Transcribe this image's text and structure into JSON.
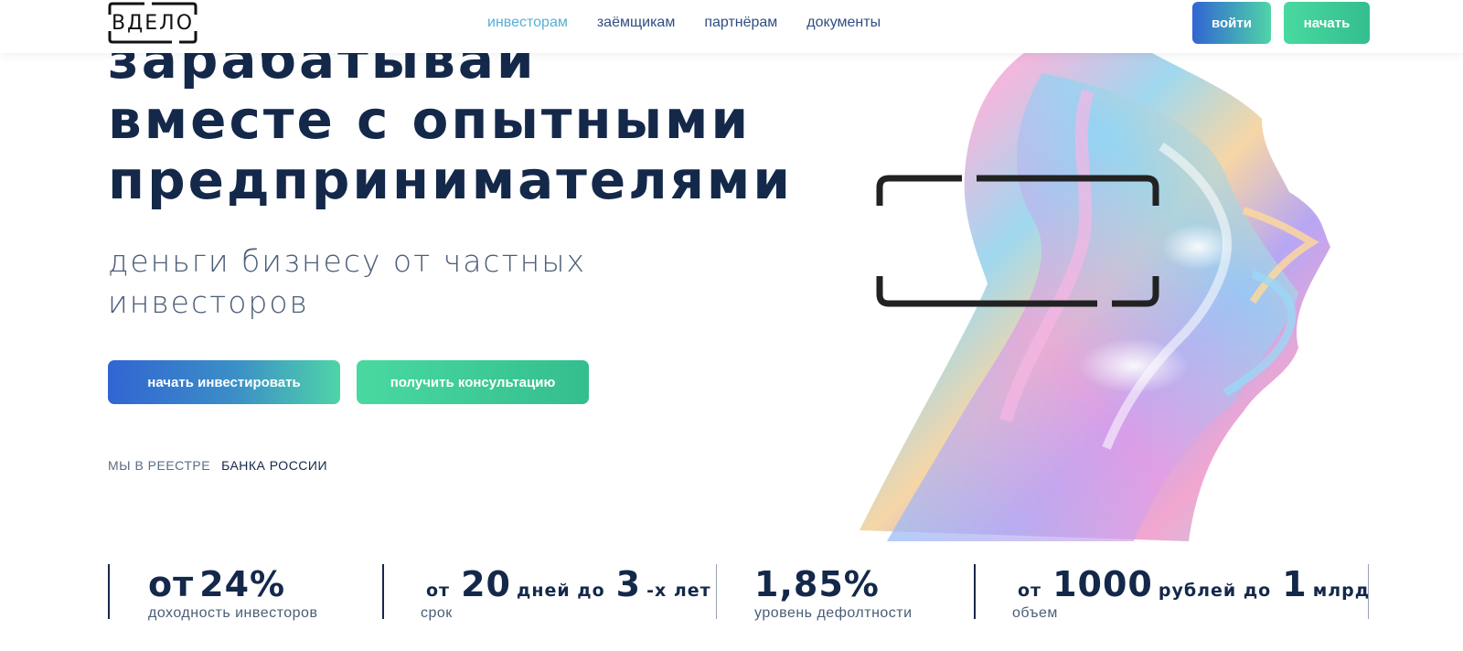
{
  "header": {
    "logo_text": "ВДЕЛО",
    "nav": [
      {
        "label": "инвесторам",
        "active": true
      },
      {
        "label": "заёмщикам",
        "active": false
      },
      {
        "label": "партнёрам",
        "active": false
      },
      {
        "label": "документы",
        "active": false
      }
    ],
    "login_label": "войти",
    "start_label": "начать"
  },
  "hero": {
    "title_lines": [
      "зарабатывай",
      "вместе с опытными",
      "предпринимателями"
    ],
    "subtitle_lines": [
      "деньги бизнесу от частных",
      "инвесторов"
    ],
    "invest_button": "начать инвестировать",
    "consult_button": "получить консультацию",
    "registry_prefix": "МЫ В РЕЕСТРЕ",
    "registry_link": "БАНКА РОССИИ"
  },
  "stats": [
    {
      "parts": [
        {
          "text": "от",
          "size": "big"
        },
        {
          "text": "24%",
          "size": "big"
        }
      ],
      "label": "доходность инвесторов"
    },
    {
      "parts": [
        {
          "text": "от",
          "size": "small"
        },
        {
          "text": "20",
          "size": "big"
        },
        {
          "text": "дней до",
          "size": "small"
        },
        {
          "text": "3",
          "size": "big"
        },
        {
          "text": "-х лет",
          "size": "small"
        }
      ],
      "label": "срок"
    },
    {
      "parts": [
        {
          "text": "1,85%",
          "size": "big"
        }
      ],
      "label": "уровень дефолтности"
    },
    {
      "parts": [
        {
          "text": "от",
          "size": "small"
        },
        {
          "text": "1000",
          "size": "big"
        },
        {
          "text": "рублей до",
          "size": "small"
        },
        {
          "text": "1",
          "size": "big"
        },
        {
          "text": "млрд",
          "size": "small"
        }
      ],
      "label": "объем"
    }
  ],
  "colors": {
    "navy": "#14284a",
    "nav_link": "#2f4e82",
    "nav_active": "#5aaed6",
    "gradient_blue": "#3165d2",
    "gradient_green": "#4fd4a8",
    "green": "#34be8e"
  },
  "icons": {
    "logo": "vdelo-bracket-logo",
    "art": "holographic-face-art",
    "art_frame": "bracket-frame-icon"
  }
}
